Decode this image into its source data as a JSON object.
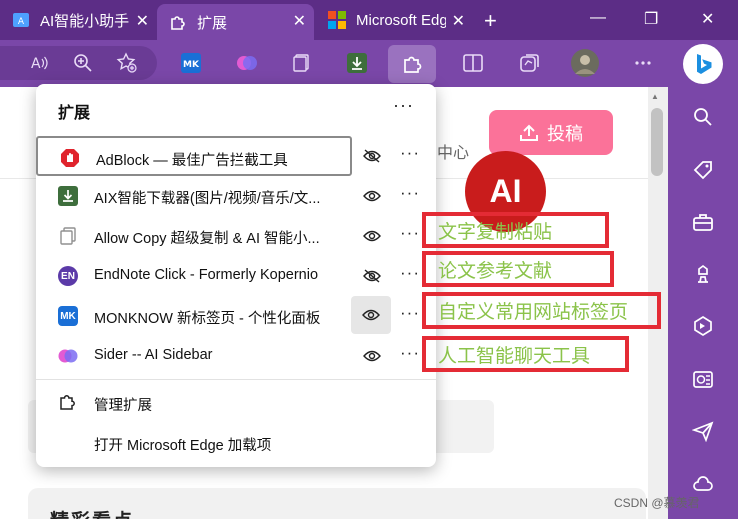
{
  "tabs": [
    {
      "label": "AI智能小助手",
      "icon": "ai-assistant-icon",
      "active": false
    },
    {
      "label": "扩展",
      "icon": "puzzle-icon",
      "active": true
    },
    {
      "label": "Microsoft Edge",
      "icon": "microsoft-logo-icon",
      "active": false
    }
  ],
  "popup": {
    "title": "扩展",
    "extensions": [
      {
        "name": "AdBlock — 最佳广告拦截工具",
        "icon": "adblock-icon",
        "icon_color": "#e0242d",
        "visible": false
      },
      {
        "name": "AIX智能下载器(图片/视频/音乐/文...",
        "icon": "aix-downloader-icon",
        "icon_color": "#3e6e3c",
        "visible": true
      },
      {
        "name": "Allow Copy 超级复制 & AI 智能小...",
        "icon": "allow-copy-icon",
        "icon_color": "#a0a0a0",
        "visible": true
      },
      {
        "name": "EndNote Click - Formerly Kopernio",
        "icon": "endnote-icon",
        "icon_color": "#5b3aa8",
        "icon_text": "EN",
        "visible": false
      },
      {
        "name": "MONKNOW 新标签页 - 个性化面板",
        "icon": "monknow-icon",
        "icon_color": "#1a6fd6",
        "icon_text": "MK",
        "visible": true
      },
      {
        "name": "Sider -- AI Sidebar",
        "icon": "sider-icon",
        "icon_color": "#c04de0",
        "visible": true
      }
    ],
    "footer": {
      "manage": "管理扩展",
      "open_addons": "打开 Microsoft Edge 加载项"
    }
  },
  "annotations": [
    "文字复制粘贴",
    "论文参考文献",
    "自定义常用网站标签页",
    "人工智能聊天工具"
  ],
  "page": {
    "contribute_label": "投稿",
    "center_label": "中心",
    "ai_avatar": "AI",
    "section_title": "精彩看点"
  },
  "watermark": "CSDN @慕羡君",
  "colors": {
    "browser_purple": "#7a47a8",
    "titlebar_purple": "#5c2d86",
    "contribute_pink": "#fb7299",
    "annotation_red": "#e42b35",
    "annotation_text_green": "#8bc34a"
  }
}
